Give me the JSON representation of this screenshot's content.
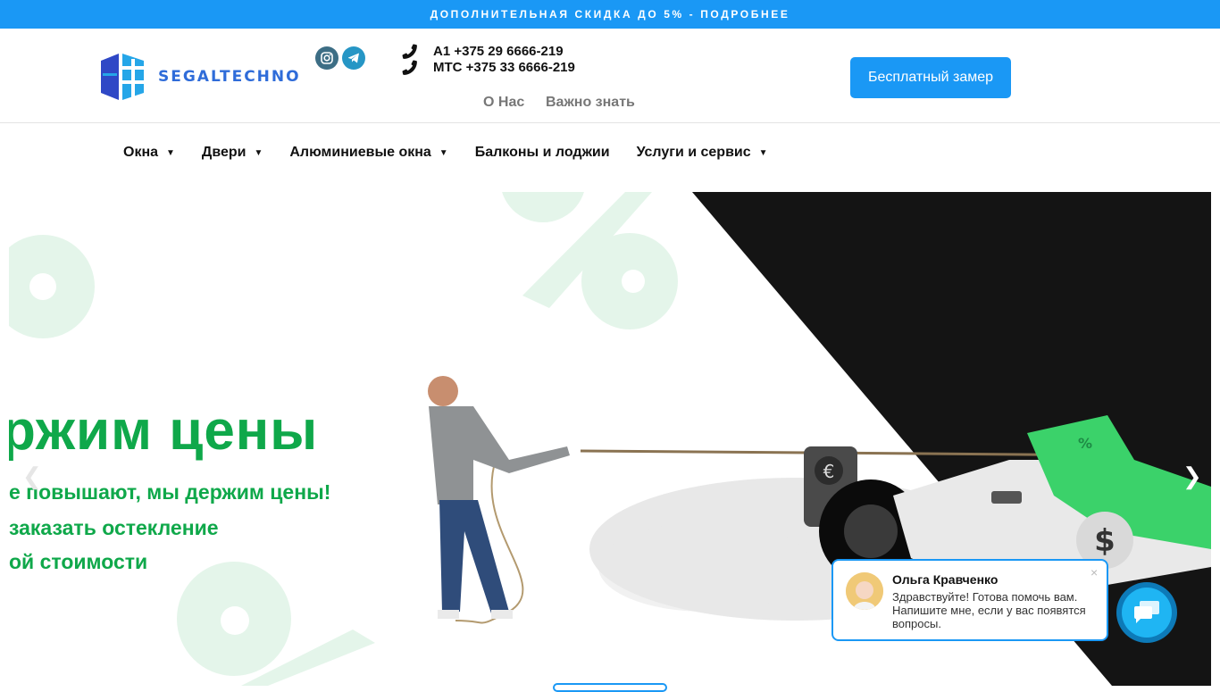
{
  "topbar": {
    "promo": "ДОПОЛНИТЕЛЬНАЯ СКИДКА ДО 5% - ПОДРОБНЕЕ"
  },
  "header": {
    "logo_text": "SEGALTECHNO",
    "phones": [
      {
        "label": "A1 +375 29 6666-219"
      },
      {
        "label": "МТС +375 33 6666-219"
      }
    ],
    "subnav": {
      "about": "О Нас",
      "know": "Важно знать"
    },
    "cta_label": "Бесплатный замер",
    "social_icons": [
      "instagram-icon",
      "telegram-icon"
    ]
  },
  "nav": {
    "items": [
      {
        "label": "Окна",
        "dropdown": true
      },
      {
        "label": "Двери",
        "dropdown": true
      },
      {
        "label": "Алюминиевые окна",
        "dropdown": true
      },
      {
        "label": "Балконы и лоджии",
        "dropdown": false
      },
      {
        "label": "Услуги и сервис",
        "dropdown": true
      }
    ]
  },
  "hero": {
    "title": "ржим цены",
    "subtitle_1": "е повышают, мы держим цены!",
    "subtitle_2": " заказать остекление",
    "subtitle_3": "ой стоимости",
    "accent_color": "#0fa84a",
    "car_badges": [
      "€",
      "$",
      "%"
    ]
  },
  "chat": {
    "agent_name": "Ольга Кравченко",
    "message": "Здравствуйте! Готова помочь вам. Напишите мне, если у вас появятся вопросы.",
    "close_symbol": "×"
  },
  "colors": {
    "brand_blue": "#1a98f5",
    "logo_blue": "#2f6cd9",
    "green": "#0fa84a"
  }
}
